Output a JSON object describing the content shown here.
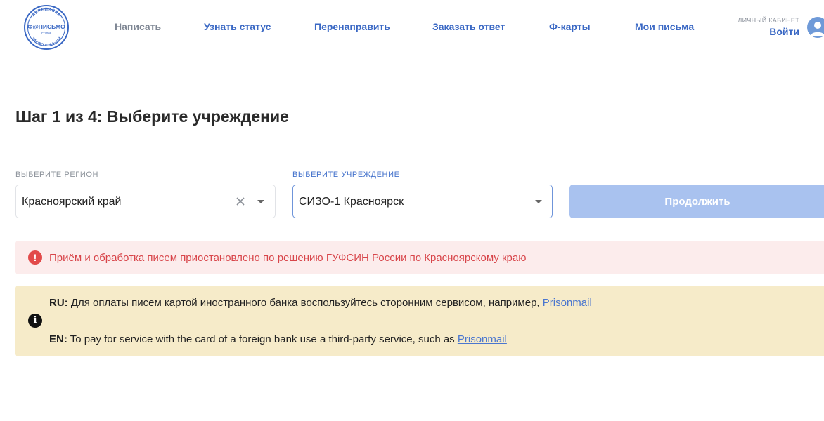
{
  "header": {
    "logo": {
      "top_text": "ПЕРЕПИСКА",
      "brand": "Ф@ПИСЬМО",
      "since": "С 2008",
      "bottom_text": "ЗАКЛЮЧЕННЫМИ"
    },
    "nav": [
      {
        "label": "Написать"
      },
      {
        "label": "Узнать статус"
      },
      {
        "label": "Перенаправить"
      },
      {
        "label": "Заказать ответ"
      },
      {
        "label": "Ф-карты"
      },
      {
        "label": "Мои письма"
      }
    ],
    "account": {
      "caption": "ЛИЧНЫЙ КАБИНЕТ",
      "login": "Войти",
      "avatar_icon": "user-avatar-icon"
    }
  },
  "page": {
    "title": "Шаг 1 из 4: Выберите учреждение"
  },
  "form": {
    "region": {
      "label": "ВЫБЕРИТЕ РЕГИОН",
      "value": "Красноярский край"
    },
    "institution": {
      "label": "ВЫБЕРИТЕ УЧРЕЖДЕНИЕ",
      "value": "СИЗО-1 Красноярск"
    },
    "continue_label": "Продолжить"
  },
  "alerts": {
    "error": {
      "icon": "!",
      "text": "Приём и обработка писем приостановлено по решению ГУФСИН России по Красноярскому краю"
    },
    "info": {
      "icon": "i",
      "ru_prefix": "RU:",
      "ru_text": "Для оплаты писем картой иностранного банка воспользуйтесь сторонним сервисом, например,",
      "ru_link": "Prisonmail",
      "en_prefix": "EN:",
      "en_text": "To pay for service with the card of a foreign bank use a third-party service, such as",
      "en_link": "Prisonmail"
    }
  },
  "colors": {
    "accent": "#3a68c4",
    "button_disabled": "#a9c2ef",
    "error_bg": "#fcecec",
    "error_text": "#d8454a",
    "info_bg": "#f6ebc9"
  }
}
